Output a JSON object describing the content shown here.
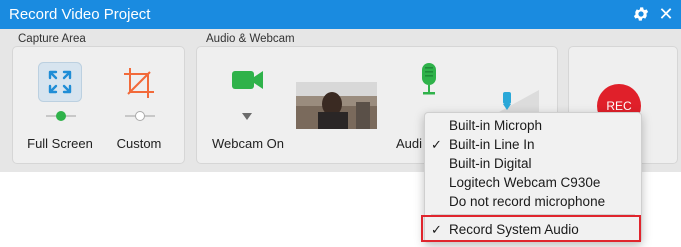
{
  "window": {
    "title": "Record Video Project",
    "accent_color": "#1a8be0"
  },
  "capture_area": {
    "section_label": "Capture Area",
    "options": [
      {
        "label": "Full Screen",
        "icon": "fullscreen-expand-icon",
        "selected": true
      },
      {
        "label": "Custom",
        "icon": "crop-icon",
        "selected": false
      }
    ]
  },
  "audio_webcam": {
    "section_label": "Audio & Webcam",
    "webcam": {
      "label": "Webcam On",
      "icon": "webcam-icon"
    },
    "audio": {
      "label": "Audi",
      "icon": "microphone-icon"
    }
  },
  "record_button": {
    "label": "REC",
    "color": "#e0202a"
  },
  "audio_menu": {
    "items": [
      {
        "label": "Built-in Microph",
        "checked": false
      },
      {
        "label": "Built-in Line In",
        "checked": true
      },
      {
        "label": "Built-in Digital",
        "checked": false
      },
      {
        "label": "Logitech Webcam C930e",
        "checked": false
      },
      {
        "label": "Do not record microphone",
        "checked": false
      }
    ],
    "system_audio": {
      "label": "Record System Audio",
      "checked": true
    },
    "check_glyph": "✓"
  }
}
